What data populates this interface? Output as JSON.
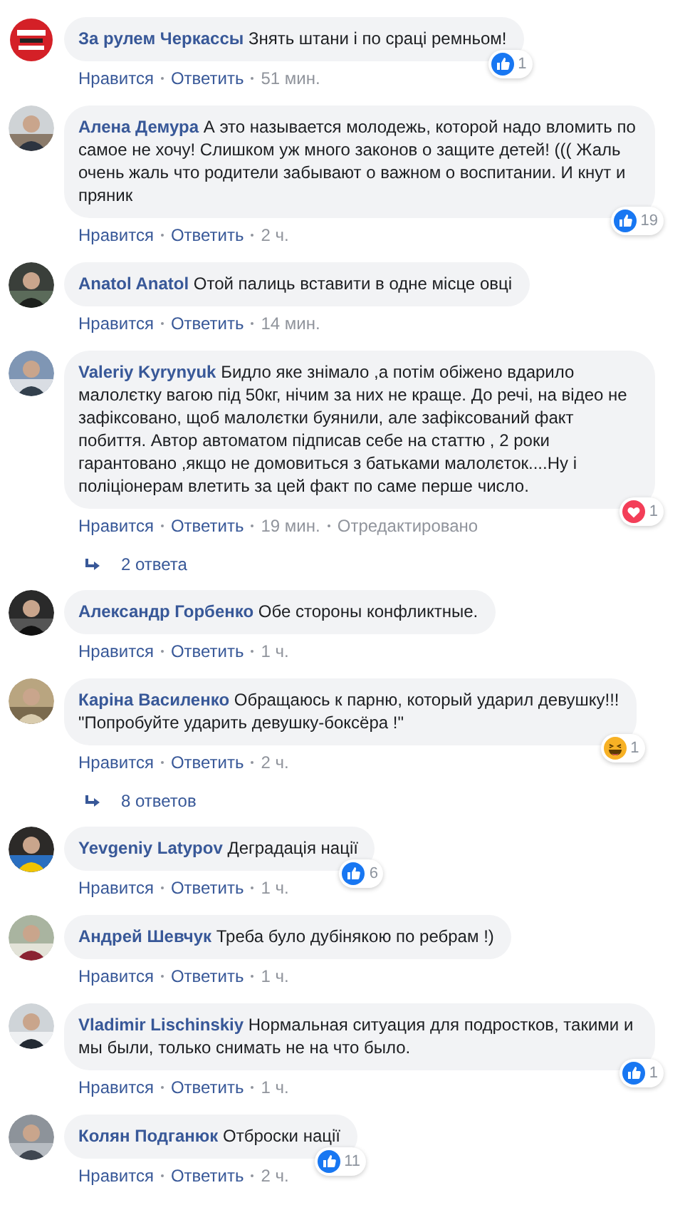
{
  "comments": [
    {
      "author": "За рулем Черкассы",
      "text": "Знять штани і по сраці ремньом!",
      "actions": [
        "Нравится",
        "Ответить"
      ],
      "time": "51 мин.",
      "reaction": {
        "kind": "like",
        "count": "1"
      }
    },
    {
      "author": "Алена Демура",
      "text": "А это называется молодежь, которой надо вломить по самое не хочу! Слишком уж много законов о защите детей! ((( Жаль очень жаль что родители забывают о важном о воспитании. И кнут и пряник",
      "actions": [
        "Нравится",
        "Ответить"
      ],
      "time": "2 ч.",
      "reaction": {
        "kind": "like",
        "count": "19"
      }
    },
    {
      "author": "Anatol Anatol",
      "text": "Отой палиць вставити в одне місце овці",
      "actions": [
        "Нравится",
        "Ответить"
      ],
      "time": "14 мин."
    },
    {
      "author": "Valeriy Kyrynyuk",
      "text": "Бидло яке знімало ,а потім обіжено вдарило малолєтку вагою під 50кг, нічим за них не краще. До речі, на відео не зафіксовано, щоб малолєтки буянили, але зафіксований факт побиття. Автор автоматом підписав себе на статтю , 2 роки гарантовано ,якщо не домовиться з батьками малолєток....Ну і поліціонерам влетить за цей факт по саме перше число.",
      "actions": [
        "Нравится",
        "Ответить"
      ],
      "time": "19 мин.",
      "edited": "Отредактировано",
      "reaction": {
        "kind": "love",
        "count": "1"
      },
      "replies": "2 ответа"
    },
    {
      "author": "Александр Горбенко",
      "text": "Обе стороны конфликтные.",
      "actions": [
        "Нравится",
        "Ответить"
      ],
      "time": "1 ч."
    },
    {
      "author": "Каріна Василенко",
      "text": "Обращаюсь к парню, который ударил девушку!!!\n\"Попробуйте ударить девушку-боксёра !\"",
      "actions": [
        "Нравится",
        "Ответить"
      ],
      "time": "2 ч.",
      "reaction": {
        "kind": "haha",
        "count": "1"
      },
      "replies": "8 ответов"
    },
    {
      "author": "Yevgeniy Latypov",
      "text": "Деградація нації",
      "actions": [
        "Нравится",
        "Ответить"
      ],
      "time": "1 ч.",
      "reaction": {
        "kind": "like",
        "count": "6"
      }
    },
    {
      "author": "Андрей Шевчук",
      "text": "Треба було дубінякою по ребрам !)",
      "actions": [
        "Нравится",
        "Ответить"
      ],
      "time": "1 ч."
    },
    {
      "author": "Vladimir Lischinskiy",
      "text": "Нормальная ситуация для подростков, такими и мы были, только снимать не на что было.",
      "actions": [
        "Нравится",
        "Ответить"
      ],
      "time": "1 ч.",
      "reaction": {
        "kind": "like",
        "count": "1"
      }
    },
    {
      "author": "Колян Подганюк",
      "text": "Отброски нації",
      "actions": [
        "Нравится",
        "Ответить"
      ],
      "time": "2 ч.",
      "reaction": {
        "kind": "like",
        "count": "11"
      }
    }
  ]
}
